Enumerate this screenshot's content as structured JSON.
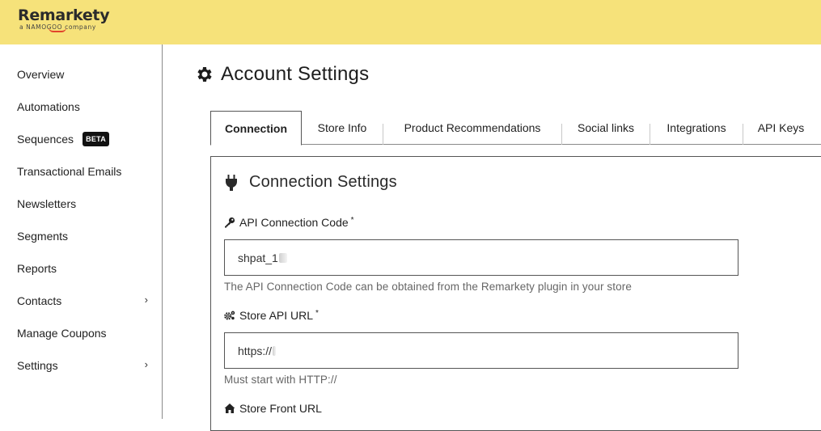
{
  "brand": {
    "name_part1": "Rem",
    "name_part2": "arkety",
    "tagline": "a NAMOGOO company",
    "accent": "#e2432b",
    "bar_color": "#f6e27a"
  },
  "sidebar": {
    "items": [
      {
        "label": "Overview"
      },
      {
        "label": "Automations"
      },
      {
        "label": "Sequences",
        "badge": "BETA"
      },
      {
        "label": "Transactional Emails"
      },
      {
        "label": "Newsletters"
      },
      {
        "label": "Segments"
      },
      {
        "label": "Reports"
      },
      {
        "label": "Contacts",
        "chevron": "chevron-right-icon"
      },
      {
        "label": "Manage Coupons"
      },
      {
        "label": "Settings",
        "chevron": "chevron-right-icon"
      }
    ]
  },
  "page": {
    "title": "Account Settings",
    "title_icon": "gear-icon"
  },
  "tabs": [
    {
      "label": "Connection",
      "active": true
    },
    {
      "label": "Store Info"
    },
    {
      "label": "Product Recommendations"
    },
    {
      "label": "Social links"
    },
    {
      "label": "Integrations"
    },
    {
      "label": "API Keys"
    }
  ],
  "connection": {
    "title": "Connection Settings",
    "title_icon": "plug-icon",
    "api_code": {
      "label": "API Connection Code",
      "required_mark": "*",
      "icon": "key-icon",
      "value": "shpat_1",
      "help": "The API Connection Code can be obtained from the Remarkety plugin in your store"
    },
    "store_api_url": {
      "label": "Store API URL",
      "required_mark": "*",
      "icon": "gears-icon",
      "value": "https://",
      "help": "Must start with HTTP://"
    },
    "store_front_url": {
      "label": "Store Front URL",
      "icon": "home-icon"
    }
  }
}
